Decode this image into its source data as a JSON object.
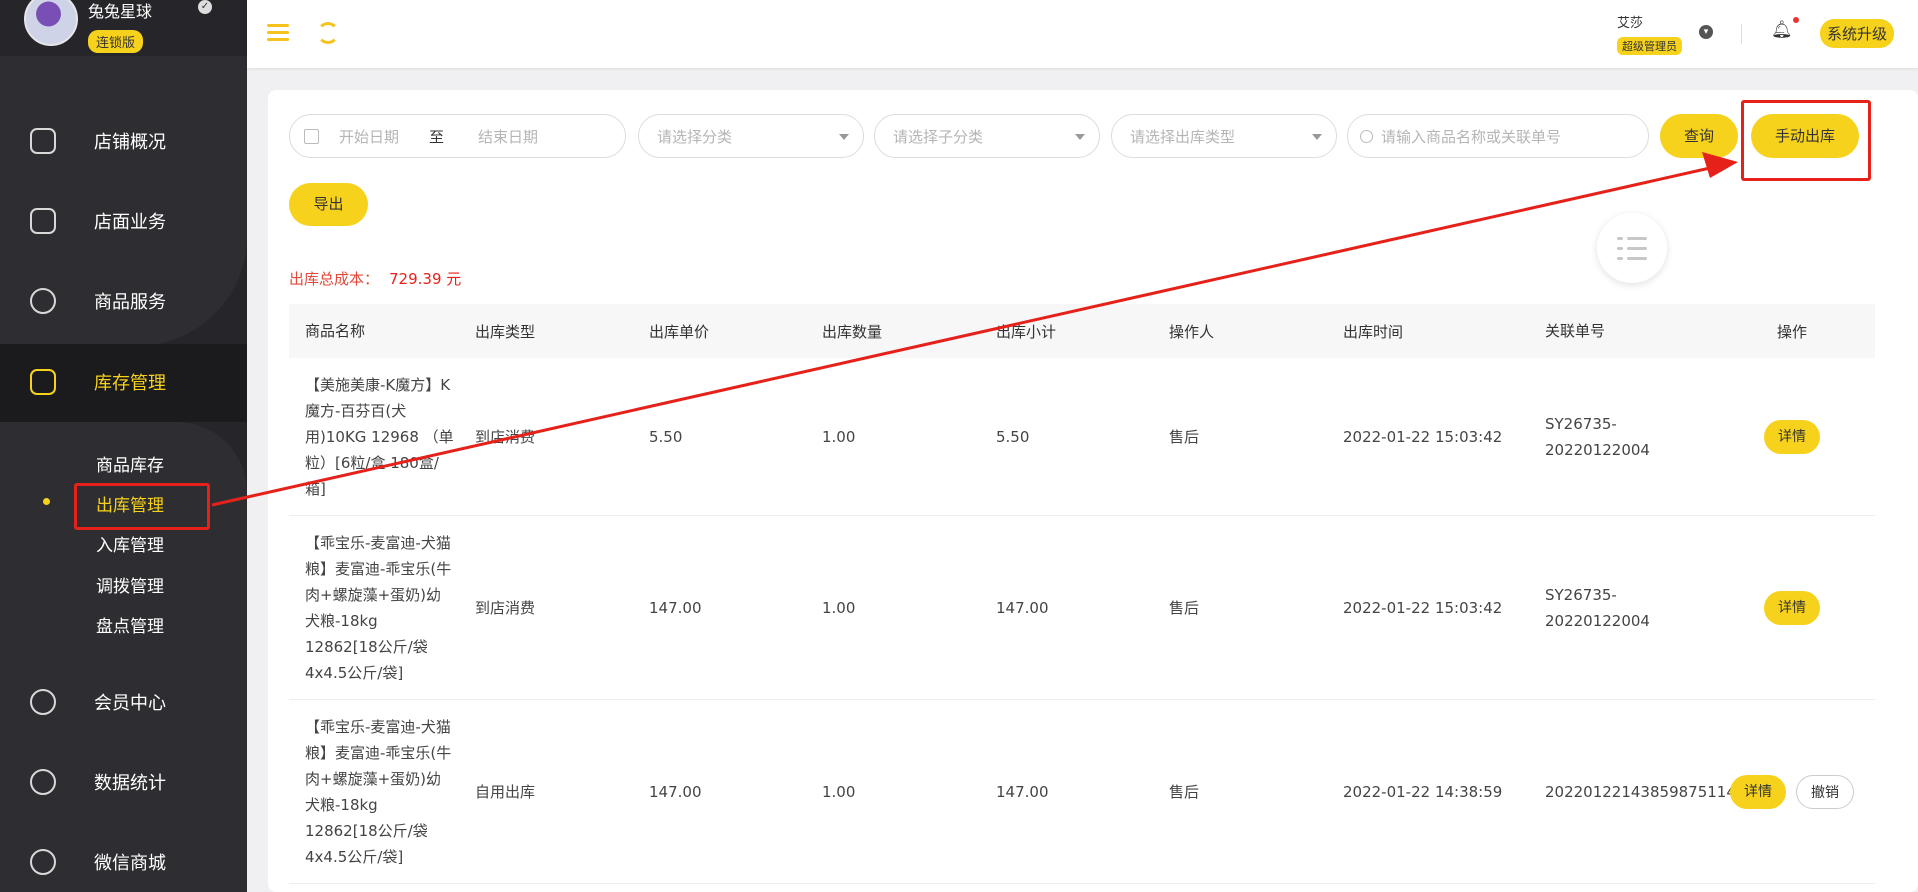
{
  "brand": {
    "name": "兔兔星球",
    "edition": "连锁版"
  },
  "sidebar": {
    "items": [
      {
        "label": "店铺概况",
        "icon": "monitor-icon"
      },
      {
        "label": "店面业务",
        "icon": "house-icon"
      },
      {
        "label": "商品服务",
        "icon": "bag-icon"
      },
      {
        "label": "库存管理",
        "icon": "warehouse-icon",
        "active": true
      },
      {
        "label": "会员中心",
        "icon": "member-icon"
      },
      {
        "label": "数据统计",
        "icon": "chart-icon"
      },
      {
        "label": "微信商城",
        "icon": "wechat-icon"
      }
    ],
    "sub_items": [
      {
        "label": "商品库存"
      },
      {
        "label": "出库管理",
        "active": true
      },
      {
        "label": "入库管理"
      },
      {
        "label": "调拨管理"
      },
      {
        "label": "盘点管理"
      }
    ]
  },
  "header": {
    "user_name": "艾莎",
    "user_role": "超级管理员",
    "upgrade_label": "系统升级"
  },
  "filters": {
    "start_date_placeholder": "开始日期",
    "to_label": "至",
    "end_date_placeholder": "结束日期",
    "category_placeholder": "请选择分类",
    "subcategory_placeholder": "请选择子分类",
    "outbound_type_placeholder": "请选择出库类型",
    "search_placeholder": "请输入商品名称或关联单号",
    "query_label": "查询",
    "manual_outbound_label": "手动出库",
    "export_label": "导出"
  },
  "summary": {
    "label": "出库总成本：",
    "value": "729.39 元"
  },
  "table": {
    "columns": [
      "商品名称",
      "出库类型",
      "出库单价",
      "出库数量",
      "出库小计",
      "操作人",
      "出库时间",
      "关联单号",
      "操作"
    ],
    "rows": [
      {
        "name": "【美施美康-K魔方】K魔方-百芬百(犬用)10KG 12968 （单粒）[6粒/盒 180盒/箱]",
        "type": "到店消费",
        "unit_price": "5.50",
        "quantity": "1.00",
        "subtotal": "5.50",
        "operator": "售后",
        "time": "2022-01-22 15:03:42",
        "order_no": "SY26735-20220122004",
        "actions": [
          "详情"
        ]
      },
      {
        "name": "【乖宝乐-麦富迪-犬猫粮】麦富迪-乖宝乐(牛肉+螺旋藻+蛋奶)幼犬粮-18kg 12862[18公斤/袋 4x4.5公斤/袋]",
        "type": "到店消费",
        "unit_price": "147.00",
        "quantity": "1.00",
        "subtotal": "147.00",
        "operator": "售后",
        "time": "2022-01-22 15:03:42",
        "order_no": "SY26735-20220122004",
        "actions": [
          "详情"
        ]
      },
      {
        "name": "【乖宝乐-麦富迪-犬猫粮】麦富迪-乖宝乐(牛肉+螺旋藻+蛋奶)幼犬粮-18kg 12862[18公斤/袋 4x4.5公斤/袋]",
        "type": "自用出库",
        "unit_price": "147.00",
        "quantity": "1.00",
        "subtotal": "147.00",
        "operator": "售后",
        "time": "2022-01-22 14:38:59",
        "order_no": "20220122143859875114",
        "actions": [
          "详情",
          "撤销"
        ]
      }
    ]
  },
  "colors": {
    "accent": "#f6d21d",
    "sidebar_bg": "#26262a",
    "annotation": "#e6211a"
  }
}
